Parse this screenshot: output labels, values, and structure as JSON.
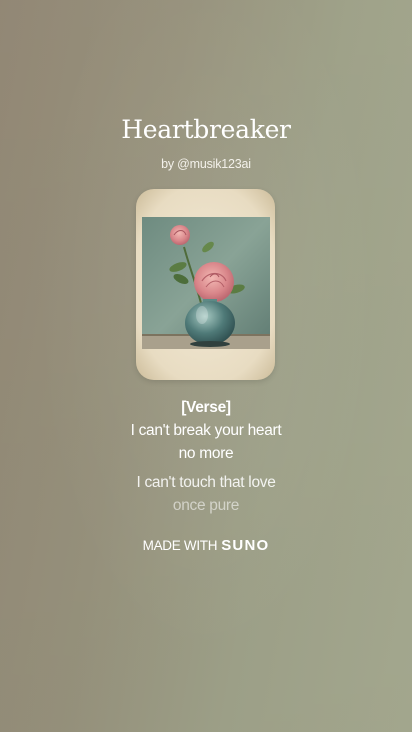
{
  "song": {
    "title": "Heartbreaker",
    "artist": "by @musik123ai"
  },
  "lyrics": {
    "section": "[Verse]",
    "lines": [
      "I can't break your heart",
      "no more",
      "I can't touch that love",
      "once pure"
    ]
  },
  "footer": {
    "made_with": "MADE WITH",
    "brand": "SUNO"
  },
  "colors": {
    "text": "#ffffff"
  }
}
